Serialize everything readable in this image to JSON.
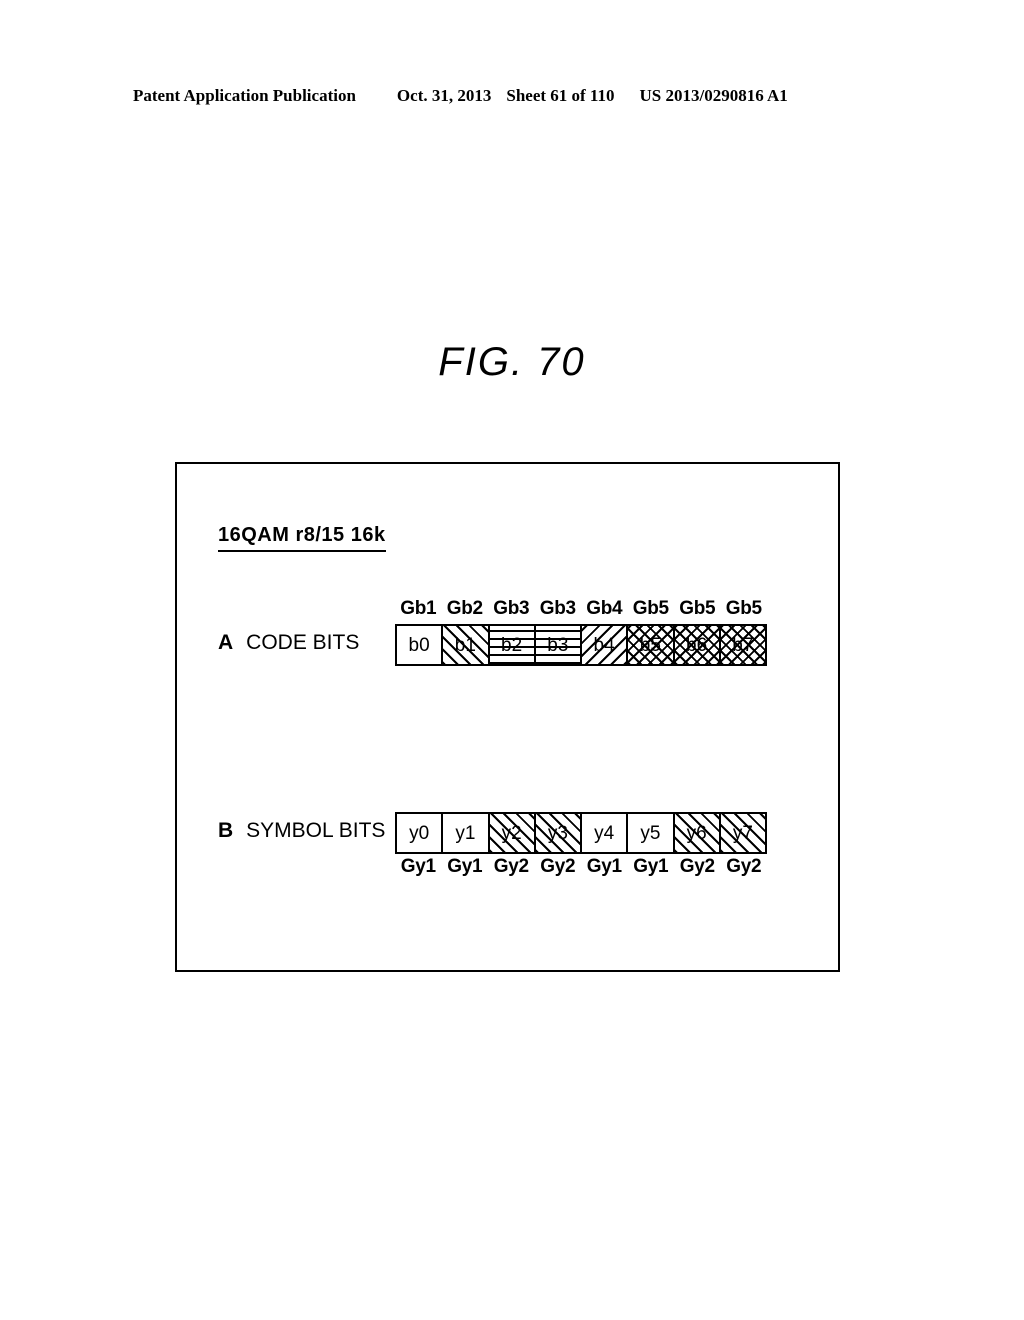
{
  "header": {
    "publication": "Patent Application Publication",
    "date": "Oct. 31, 2013",
    "sheet": "Sheet 61 of 110",
    "patent_number": "US 2013/0290816 A1"
  },
  "figure": {
    "title": "FIG. 70",
    "mode_caption": "16QAM r8/15 16k"
  },
  "code_bits": {
    "section_letter": "A",
    "section_label": "CODE BITS",
    "group_labels": [
      "Gb1",
      "Gb2",
      "Gb3",
      "Gb3",
      "Gb4",
      "Gb5",
      "Gb5",
      "Gb5"
    ],
    "cells": [
      {
        "label": "b0",
        "fill": "none"
      },
      {
        "label": "b1",
        "fill": "diag-fwd"
      },
      {
        "label": "b2",
        "fill": "horiz"
      },
      {
        "label": "b3",
        "fill": "horiz"
      },
      {
        "label": "b4",
        "fill": "diag-back"
      },
      {
        "label": "b5",
        "fill": "cross"
      },
      {
        "label": "b6",
        "fill": "cross"
      },
      {
        "label": "b7",
        "fill": "cross"
      }
    ]
  },
  "symbol_bits": {
    "section_letter": "B",
    "section_label": "SYMBOL BITS",
    "group_labels": [
      "Gy1",
      "Gy1",
      "Gy2",
      "Gy2",
      "Gy1",
      "Gy1",
      "Gy2",
      "Gy2"
    ],
    "cells": [
      {
        "label": "y0",
        "fill": "none"
      },
      {
        "label": "y1",
        "fill": "none"
      },
      {
        "label": "y2",
        "fill": "diag-fwd"
      },
      {
        "label": "y3",
        "fill": "diag-fwd"
      },
      {
        "label": "y4",
        "fill": "none"
      },
      {
        "label": "y5",
        "fill": "none"
      },
      {
        "label": "y6",
        "fill": "diag-fwd"
      },
      {
        "label": "y7",
        "fill": "diag-fwd"
      }
    ]
  },
  "colors": {
    "ink": "#000000",
    "paper": "#ffffff"
  }
}
